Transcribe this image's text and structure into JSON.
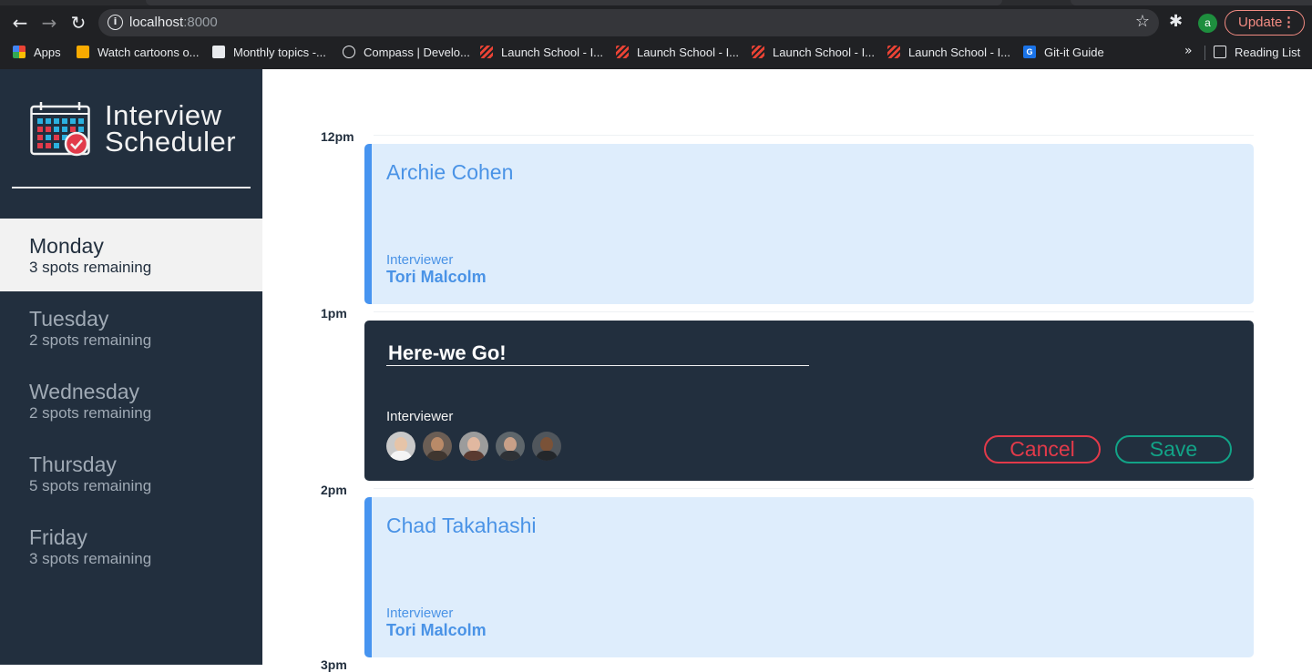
{
  "browser": {
    "url_host": "localhost",
    "url_port": ":8000",
    "update_label": "Update",
    "profile_initial": "a",
    "bookmarks": [
      {
        "label": "Apps",
        "icon": "apps-grid-icon"
      },
      {
        "label": "Watch cartoons o...",
        "icon": "cartoon-icon"
      },
      {
        "label": "Monthly topics -...",
        "icon": "document-icon"
      },
      {
        "label": "Compass | Develo...",
        "icon": "compass-icon"
      },
      {
        "label": "Launch School - I...",
        "icon": "launch-school-icon"
      },
      {
        "label": "Launch School - I...",
        "icon": "launch-school-icon"
      },
      {
        "label": "Launch School - I...",
        "icon": "launch-school-icon"
      },
      {
        "label": "Launch School - I...",
        "icon": "launch-school-icon"
      },
      {
        "label": "Git-it Guide",
        "icon": "gitit-icon"
      }
    ],
    "reading_list_label": "Reading List",
    "more_bookmarks": "»"
  },
  "app": {
    "title_line1": "Interview",
    "title_line2": "Scheduler"
  },
  "days": [
    {
      "name": "Monday",
      "spots": "3 spots remaining",
      "selected": true
    },
    {
      "name": "Tuesday",
      "spots": "2 spots remaining",
      "selected": false
    },
    {
      "name": "Wednesday",
      "spots": "2 spots remaining",
      "selected": false
    },
    {
      "name": "Thursday",
      "spots": "5 spots remaining",
      "selected": false
    },
    {
      "name": "Friday",
      "spots": "3 spots remaining",
      "selected": false
    }
  ],
  "schedule": {
    "times": [
      "12pm",
      "1pm",
      "2pm",
      "3pm"
    ],
    "appointments": [
      {
        "student": "Archie Cohen",
        "interviewer_label": "Interviewer",
        "interviewer": "Tori Malcolm"
      },
      {
        "student": "Chad Takahashi",
        "interviewer_label": "Interviewer",
        "interviewer": "Tori Malcolm"
      }
    ],
    "form": {
      "student_value": "Here-we Go!",
      "interviewer_label": "Interviewer",
      "cancel_label": "Cancel",
      "save_label": "Save"
    }
  },
  "colors": {
    "sidebar_bg": "#222f3e",
    "appointment_bg": "#deedfc",
    "appointment_accent": "#4794f0",
    "cancel": "#e23a4a",
    "save": "#12a387"
  }
}
